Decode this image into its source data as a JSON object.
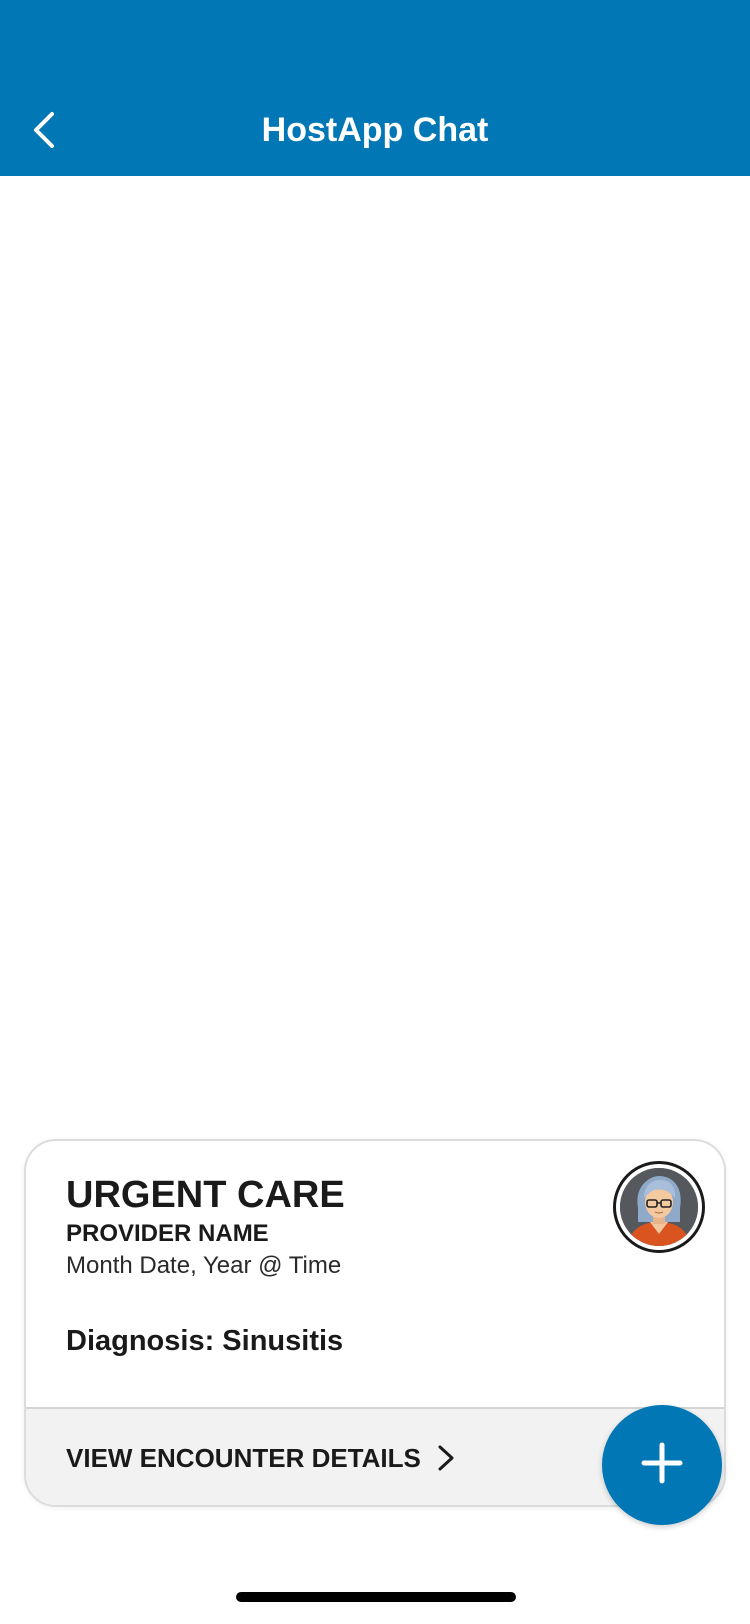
{
  "header": {
    "title": "HostApp Chat",
    "background_color": "#0277b6",
    "back_icon": "chevron-left-icon"
  },
  "encounter_card": {
    "title": "URGENT CARE",
    "provider": "PROVIDER NAME",
    "date": "Month Date, Year @ Time",
    "diagnosis": "Diagnosis: Sinusitis",
    "avatar_icon": "provider-avatar",
    "footer": {
      "label": "VIEW ENCOUNTER DETAILS",
      "chevron_icon": "chevron-right-icon"
    }
  },
  "fab": {
    "icon": "plus-icon",
    "color": "#0277b6"
  }
}
